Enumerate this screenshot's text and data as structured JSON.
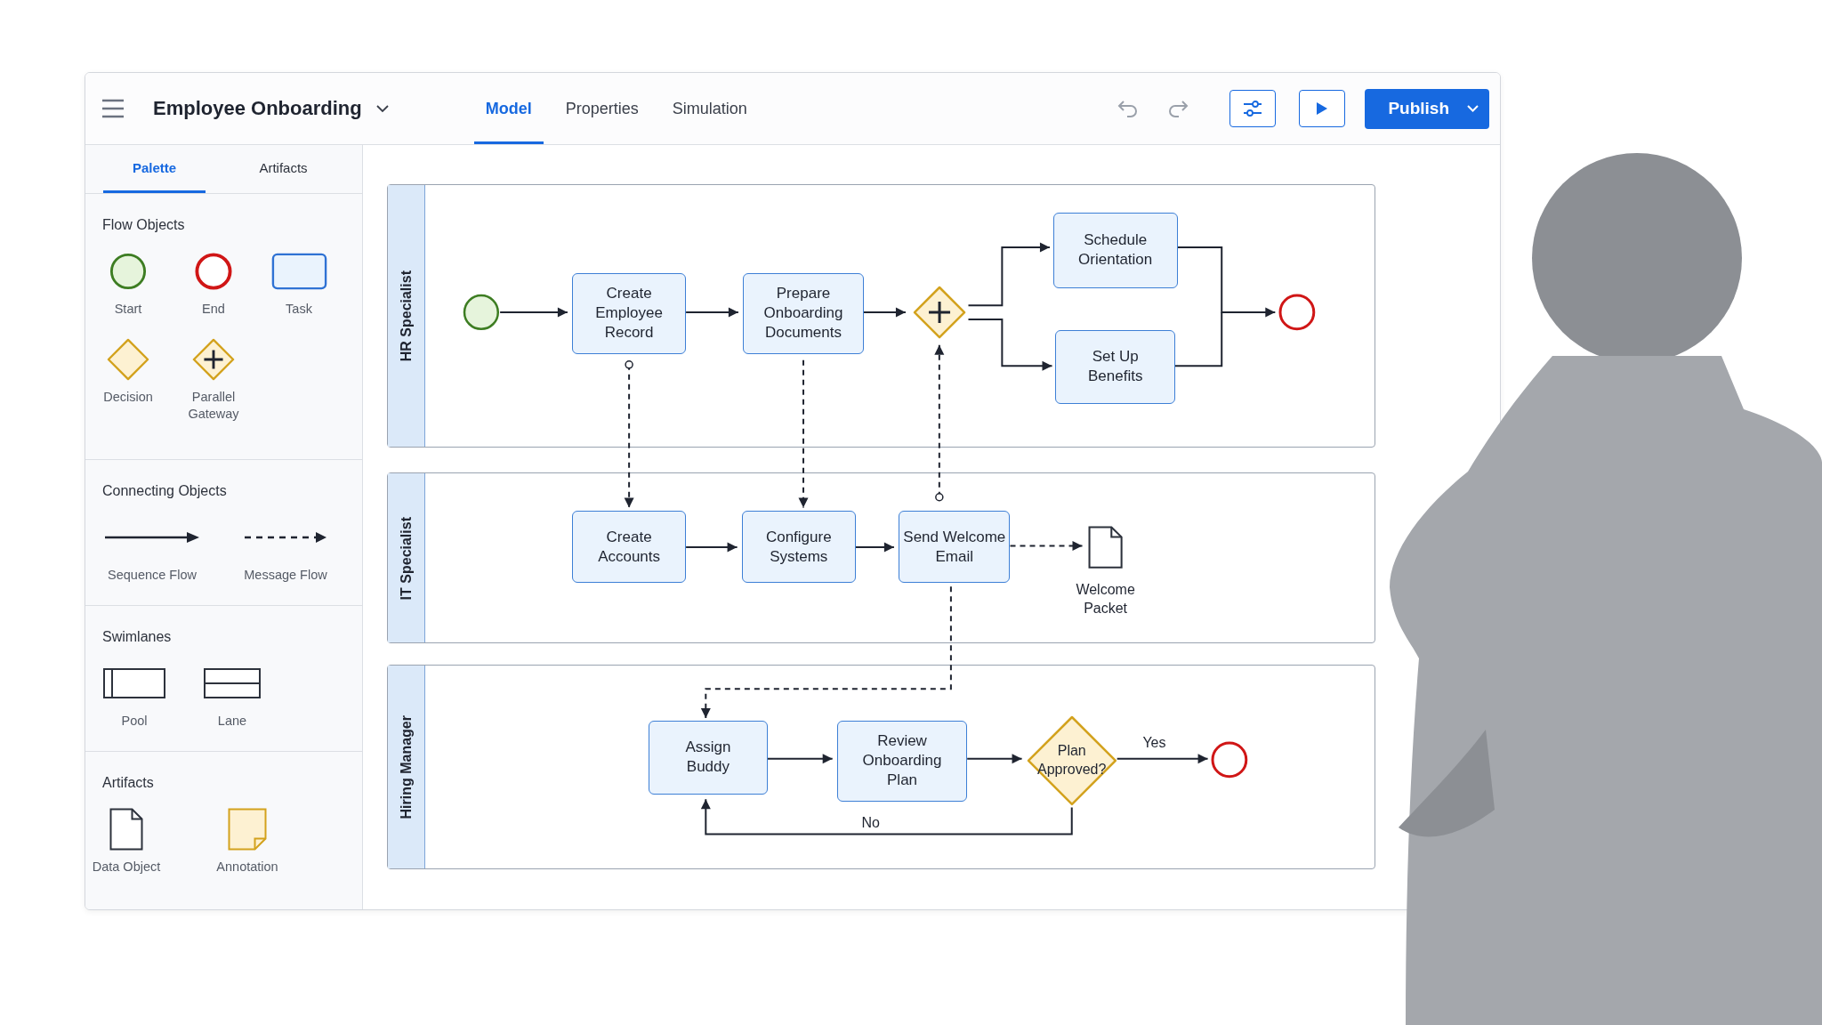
{
  "window": {
    "title": "Employee Onboarding"
  },
  "tabs": [
    {
      "label": "Model",
      "selected": true
    },
    {
      "label": "Properties",
      "selected": false
    },
    {
      "label": "Simulation",
      "selected": false
    }
  ],
  "toolbar": {
    "publish": "Publish"
  },
  "sidebar": {
    "tabs": [
      {
        "label": "Palette",
        "selected": true
      },
      {
        "label": "Artifacts",
        "selected": false
      }
    ],
    "sections": [
      {
        "title": "Flow Objects",
        "items": [
          {
            "kind": "start",
            "label": "Start"
          },
          {
            "kind": "end",
            "label": "End"
          },
          {
            "kind": "task",
            "label": "Task"
          },
          {
            "kind": "decision",
            "label": "Decision"
          },
          {
            "kind": "parallel",
            "label": "Parallel Gateway"
          }
        ]
      },
      {
        "title": "Connecting Objects",
        "items": [
          {
            "kind": "sequence",
            "label": "Sequence Flow"
          },
          {
            "kind": "message",
            "label": "Message Flow"
          }
        ]
      },
      {
        "title": "Swimlanes",
        "items": [
          {
            "kind": "pool",
            "label": "Pool"
          },
          {
            "kind": "lane",
            "label": "Lane"
          }
        ]
      },
      {
        "title": "Artifacts",
        "items": [
          {
            "kind": "data",
            "label": "Data Object"
          },
          {
            "kind": "annotation",
            "label": "Annotation"
          }
        ]
      }
    ]
  },
  "canvas": {
    "lanes": [
      {
        "label": "HR Specialist"
      },
      {
        "label": "IT Specialist"
      },
      {
        "label": "Hiring Manager"
      }
    ],
    "nodes": [
      {
        "kind": "start"
      },
      {
        "kind": "task",
        "label": "Create Employee Record"
      },
      {
        "kind": "task",
        "label": "Prepare Onboarding Documents"
      },
      {
        "kind": "parallel"
      },
      {
        "kind": "task",
        "label": "Schedule Orientation"
      },
      {
        "kind": "task",
        "label": "Set Up Benefits"
      },
      {
        "kind": "end"
      },
      {
        "kind": "task",
        "label": "Create Accounts"
      },
      {
        "kind": "task",
        "label": "Configure Systems"
      },
      {
        "kind": "task",
        "label": "Send Welcome Email"
      },
      {
        "kind": "data",
        "label": "Welcome Packet"
      },
      {
        "kind": "task",
        "label": "Assign Buddy"
      },
      {
        "kind": "task",
        "label": "Review Onboarding Plan"
      },
      {
        "kind": "decision",
        "label": "Plan Approved?"
      },
      {
        "kind": "end"
      }
    ],
    "flow_labels": [
      "Yes",
      "No"
    ]
  }
}
